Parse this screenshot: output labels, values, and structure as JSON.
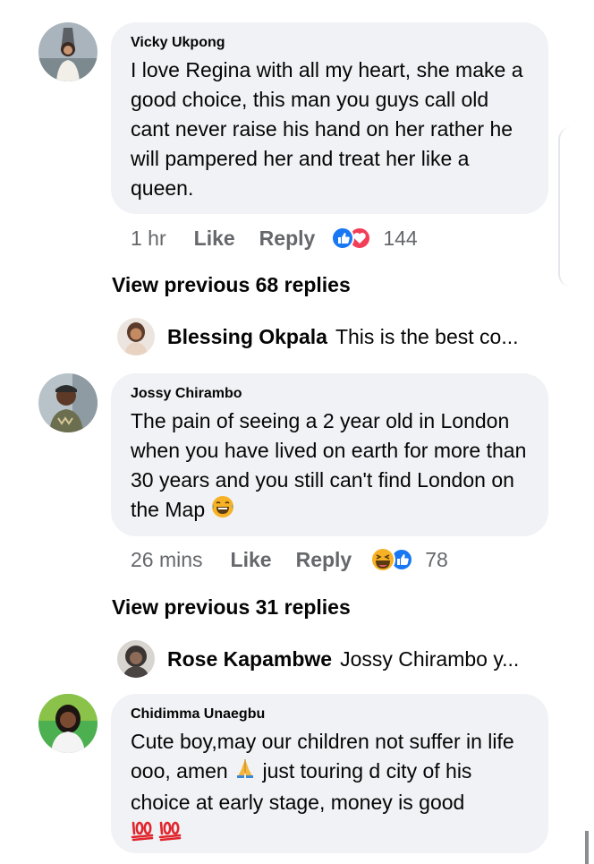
{
  "comments": [
    {
      "author": "Vicky Ukpong",
      "text": "I love Regina  with all my heart, she make a good choice, this man you guys call old cant never raise his hand on her rather he will pampered her and treat her like a queen.",
      "time": "1 hr",
      "like_label": "Like",
      "reply_label": "Reply",
      "reaction_icons": [
        "like-icon",
        "love-icon"
      ],
      "reaction_count": "144",
      "view_previous": "View previous 68 replies",
      "preview_author": "Blessing Okpala",
      "preview_text": "This is the best co..."
    },
    {
      "author": "Jossy Chirambo",
      "text": "The pain of seeing a 2 year old in London when you have lived on earth for more than 30 years and you still can't find London on the Map",
      "text_emoji": "laughing-crying-emoji",
      "time": "26 mins",
      "like_label": "Like",
      "reply_label": "Reply",
      "reaction_icons": [
        "haha-icon",
        "like-icon"
      ],
      "reaction_count": "78",
      "view_previous": "View previous 31 replies",
      "preview_author": "Rose Kapambwe",
      "preview_text": "Jossy Chirambo y..."
    },
    {
      "author": "Chidimma Unaegbu",
      "text_part1": "Cute boy,may our children not suffer in life ooo, amen",
      "text_emoji1": "praying-hands-emoji",
      "text_part2": "just touring d city of his choice at early stage, money is good",
      "text_emoji2": "hundred-points-emoji"
    }
  ],
  "colors": {
    "bubble": "#f0f2f5",
    "meta_text": "#65676b",
    "like_blue": "#1877f2",
    "love_red": "#f33e58",
    "haha_yellow": "#f7b125"
  }
}
